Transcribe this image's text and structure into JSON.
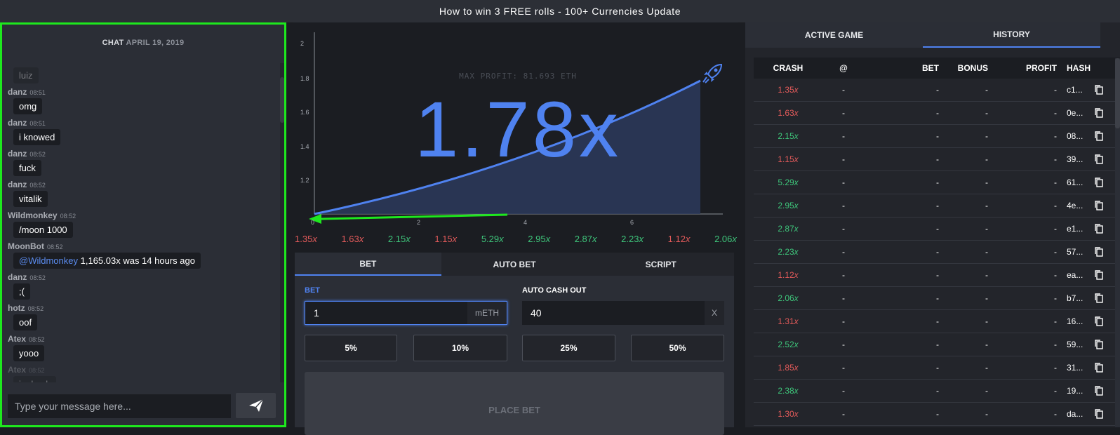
{
  "topbar": {
    "title": "How to win 3 FREE rolls - 100+ Currencies Update"
  },
  "chat": {
    "header_label": "CHAT",
    "header_date": "APRIL 19, 2019",
    "messages": [
      {
        "user": "",
        "time": "",
        "text": "luiz",
        "fade": true,
        "mention": ""
      },
      {
        "user": "danz",
        "time": "08:51",
        "text": "omg",
        "mention": ""
      },
      {
        "user": "danz",
        "time": "08:51",
        "text": "i knowed",
        "mention": ""
      },
      {
        "user": "danz",
        "time": "08:52",
        "text": "fuck",
        "mention": ""
      },
      {
        "user": "danz",
        "time": "08:52",
        "text": "vitalik",
        "mention": ""
      },
      {
        "user": "Wildmonkey",
        "time": "08:52",
        "text": "/moon 1000",
        "mention": ""
      },
      {
        "user": "MoonBot",
        "time": "08:52",
        "text": " 1,165.03x was 14 hours ago",
        "mention": "@Wildmonkey"
      },
      {
        "user": "danz",
        "time": "08:52",
        "text": ";(",
        "mention": ""
      },
      {
        "user": "hotz",
        "time": "08:52",
        "text": "oof",
        "mention": ""
      },
      {
        "user": "Atex",
        "time": "08:52",
        "text": "yooo",
        "mention": ""
      },
      {
        "user": "Atex",
        "time": "08:52",
        "text": "im back",
        "fade": true,
        "mention": ""
      }
    ],
    "input_placeholder": "Type your message here..."
  },
  "graph": {
    "max_profit": "MAX PROFIT: 81.693 ETH",
    "multiplier": "1.78x",
    "y_ticks": [
      "2",
      "1.8",
      "1.6",
      "1.4",
      "1.2"
    ],
    "x_ticks": [
      "0",
      "2",
      "4",
      "6"
    ],
    "recent_results": [
      {
        "value": "1.35",
        "color": "red"
      },
      {
        "value": "1.63",
        "color": "red"
      },
      {
        "value": "2.15",
        "color": "green"
      },
      {
        "value": "1.15",
        "color": "red"
      },
      {
        "value": "5.29",
        "color": "green"
      },
      {
        "value": "2.95",
        "color": "green"
      },
      {
        "value": "2.87",
        "color": "green"
      },
      {
        "value": "2.23",
        "color": "green"
      },
      {
        "value": "1.12",
        "color": "red"
      },
      {
        "value": "2.06",
        "color": "green"
      }
    ]
  },
  "bet": {
    "tabs": [
      "BET",
      "AUTO BET",
      "SCRIPT"
    ],
    "bet_label": "BET",
    "bet_value": "1",
    "bet_unit": "mETH",
    "cashout_label": "AUTO CASH OUT",
    "cashout_value": "40",
    "cashout_unit": "X",
    "percent_buttons": [
      "5%",
      "10%",
      "25%",
      "50%"
    ],
    "place_label": "PLACE BET"
  },
  "history": {
    "tabs": [
      "ACTIVE GAME",
      "HISTORY"
    ],
    "columns": [
      "CRASH",
      "@",
      "BET",
      "BONUS",
      "PROFIT",
      "HASH"
    ],
    "rows": [
      {
        "crash": "1.35",
        "color": "red",
        "hash": "c1..."
      },
      {
        "crash": "1.63",
        "color": "red",
        "hash": "0e..."
      },
      {
        "crash": "2.15",
        "color": "green",
        "hash": "08..."
      },
      {
        "crash": "1.15",
        "color": "red",
        "hash": "39..."
      },
      {
        "crash": "5.29",
        "color": "green",
        "hash": "61..."
      },
      {
        "crash": "2.95",
        "color": "green",
        "hash": "4e..."
      },
      {
        "crash": "2.87",
        "color": "green",
        "hash": "e1..."
      },
      {
        "crash": "2.23",
        "color": "green",
        "hash": "57..."
      },
      {
        "crash": "1.12",
        "color": "red",
        "hash": "ea..."
      },
      {
        "crash": "2.06",
        "color": "green",
        "hash": "b7..."
      },
      {
        "crash": "1.31",
        "color": "red",
        "hash": "16..."
      },
      {
        "crash": "2.52",
        "color": "green",
        "hash": "59..."
      },
      {
        "crash": "1.85",
        "color": "red",
        "hash": "31..."
      },
      {
        "crash": "2.38",
        "color": "green",
        "hash": "19..."
      },
      {
        "crash": "1.30",
        "color": "red",
        "hash": "da..."
      }
    ],
    "dash": "-",
    "x_suffix": "x"
  },
  "colors": {
    "accent": "#4f82f0",
    "win": "#3ec47a",
    "loss": "#e25a5a",
    "highlight": "#1ee81e"
  }
}
